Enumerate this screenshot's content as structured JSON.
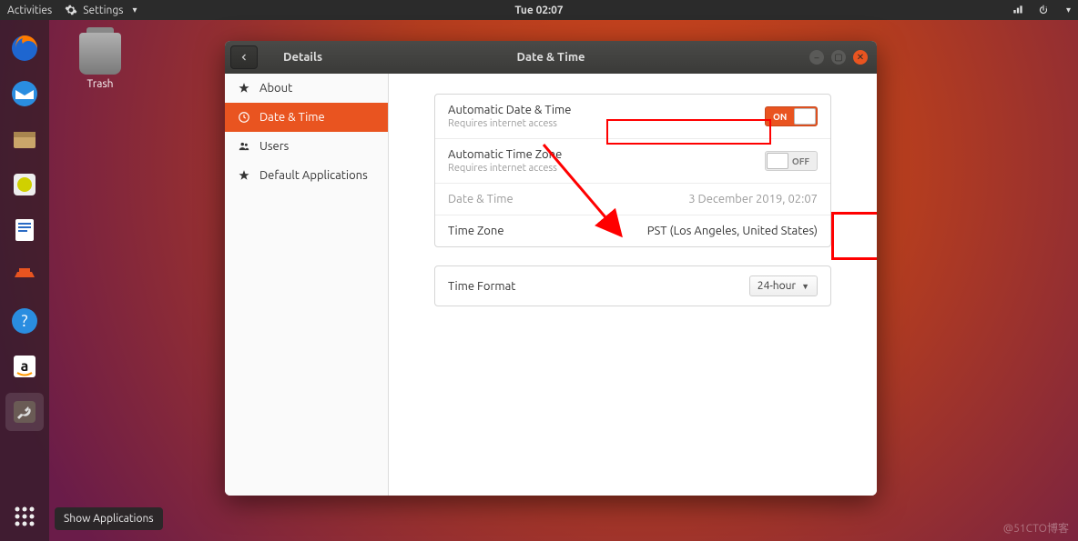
{
  "topbar": {
    "activities": "Activities",
    "app_menu": "Settings",
    "clock": "Tue 02:07"
  },
  "desktop": {
    "trash_label": "Trash"
  },
  "dock": {
    "tooltip": "Show Applications"
  },
  "window": {
    "back_title": "Details",
    "title": "Date & Time",
    "sidebar": {
      "items": [
        {
          "label": "About"
        },
        {
          "label": "Date & Time"
        },
        {
          "label": "Users"
        },
        {
          "label": "Default Applications"
        }
      ]
    },
    "content": {
      "auto_dt_label": "Automatic Date & Time",
      "auto_dt_sub": "Requires internet access",
      "auto_dt_switch": "ON",
      "auto_tz_label": "Automatic Time Zone",
      "auto_tz_sub": "Requires internet access",
      "auto_tz_switch": "OFF",
      "dt_label": "Date & Time",
      "dt_value": "3 December 2019, 02:07",
      "tz_label": "Time Zone",
      "tz_value": "PST (Los Angeles, United States)",
      "fmt_label": "Time Format",
      "fmt_value": "24-hour"
    }
  },
  "watermark": "@51CTO博客"
}
